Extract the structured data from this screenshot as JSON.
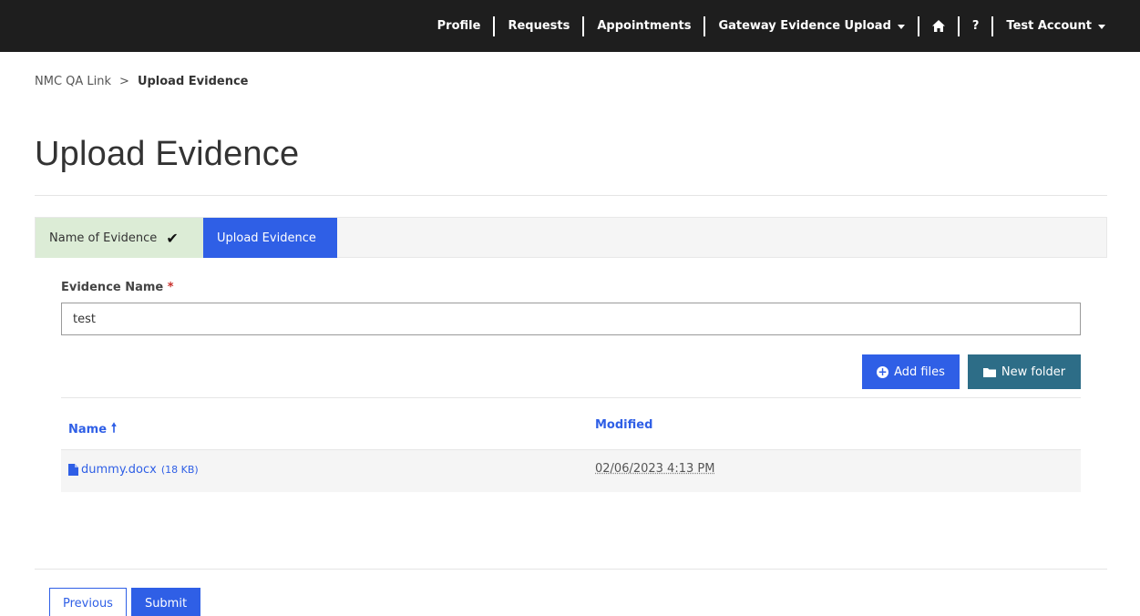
{
  "nav": {
    "profile": "Profile",
    "requests": "Requests",
    "appointments": "Appointments",
    "gateway": "Gateway Evidence Upload",
    "home_icon": "home-icon",
    "help": "?",
    "account": "Test Account"
  },
  "breadcrumb": {
    "root": "NMC QA Link",
    "separator": ">",
    "current": "Upload Evidence"
  },
  "page_title": "Upload Evidence",
  "steps": {
    "step1": "Name of Evidence",
    "step2": "Upload Evidence"
  },
  "form": {
    "label": "Evidence Name",
    "required_mark": "*",
    "value": "test"
  },
  "buttons": {
    "add_files": "Add files",
    "new_folder": "New folder",
    "previous": "Previous",
    "submit": "Submit"
  },
  "table": {
    "col_name": "Name",
    "col_modified": "Modified",
    "rows": [
      {
        "name": "dummy.docx",
        "size": "(18 KB)",
        "modified": "02/06/2023 4:13 PM"
      }
    ]
  },
  "colors": {
    "nav_bg": "#1e1e1e",
    "accent": "#2f5fe6",
    "folder_button": "#2d6d87",
    "step_done_bg": "#dcecd6"
  }
}
